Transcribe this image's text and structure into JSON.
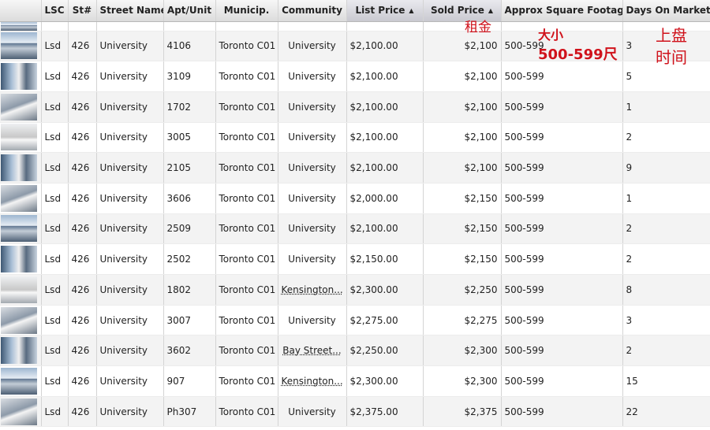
{
  "columns": [
    {
      "label": "",
      "sort": ""
    },
    {
      "label": "LSC",
      "sort": ""
    },
    {
      "label": "St#",
      "sort": ""
    },
    {
      "label": "Street Name",
      "sort": ""
    },
    {
      "label": "Apt/Unit",
      "sort": ""
    },
    {
      "label": "Municip.",
      "sort": ""
    },
    {
      "label": "Community",
      "sort": ""
    },
    {
      "label": "List Price",
      "sort": "▲"
    },
    {
      "label": "Sold Price",
      "sort": "▲"
    },
    {
      "label": "Approx Square Footage",
      "sort": ""
    },
    {
      "label": "Days On Market",
      "sort": ""
    }
  ],
  "rows": [
    {
      "lsc": "Lsd",
      "st": "426",
      "street": "University",
      "unit": "4106",
      "municip": "Toronto C01",
      "community": "University",
      "list_price": "$2,100.00",
      "sold_price": "$2,100",
      "sqft": "500-599",
      "dom": "3"
    },
    {
      "lsc": "Lsd",
      "st": "426",
      "street": "University",
      "unit": "3109",
      "municip": "Toronto C01",
      "community": "University",
      "list_price": "$2,100.00",
      "sold_price": "$2,100",
      "sqft": "500-599",
      "dom": "5"
    },
    {
      "lsc": "Lsd",
      "st": "426",
      "street": "University",
      "unit": "1702",
      "municip": "Toronto C01",
      "community": "University",
      "list_price": "$2,100.00",
      "sold_price": "$2,100",
      "sqft": "500-599",
      "dom": "1"
    },
    {
      "lsc": "Lsd",
      "st": "426",
      "street": "University",
      "unit": "3005",
      "municip": "Toronto C01",
      "community": "University",
      "list_price": "$2,100.00",
      "sold_price": "$2,100",
      "sqft": "500-599",
      "dom": "2"
    },
    {
      "lsc": "Lsd",
      "st": "426",
      "street": "University",
      "unit": "2105",
      "municip": "Toronto C01",
      "community": "University",
      "list_price": "$2,100.00",
      "sold_price": "$2,100",
      "sqft": "500-599",
      "dom": "9"
    },
    {
      "lsc": "Lsd",
      "st": "426",
      "street": "University",
      "unit": "3606",
      "municip": "Toronto C01",
      "community": "University",
      "list_price": "$2,000.00",
      "sold_price": "$2,150",
      "sqft": "500-599",
      "dom": "1"
    },
    {
      "lsc": "Lsd",
      "st": "426",
      "street": "University",
      "unit": "2509",
      "municip": "Toronto C01",
      "community": "University",
      "list_price": "$2,100.00",
      "sold_price": "$2,150",
      "sqft": "500-599",
      "dom": "2"
    },
    {
      "lsc": "Lsd",
      "st": "426",
      "street": "University",
      "unit": "2502",
      "municip": "Toronto C01",
      "community": "University",
      "list_price": "$2,150.00",
      "sold_price": "$2,150",
      "sqft": "500-599",
      "dom": "2"
    },
    {
      "lsc": "Lsd",
      "st": "426",
      "street": "University",
      "unit": "1802",
      "municip": "Toronto C01",
      "community": "Kensington...",
      "list_price": "$2,300.00",
      "sold_price": "$2,250",
      "sqft": "500-599",
      "dom": "8"
    },
    {
      "lsc": "Lsd",
      "st": "426",
      "street": "University",
      "unit": "3007",
      "municip": "Toronto C01",
      "community": "University",
      "list_price": "$2,275.00",
      "sold_price": "$2,275",
      "sqft": "500-599",
      "dom": "3"
    },
    {
      "lsc": "Lsd",
      "st": "426",
      "street": "University",
      "unit": "3602",
      "municip": "Toronto C01",
      "community": "Bay Street...",
      "list_price": "$2,250.00",
      "sold_price": "$2,300",
      "sqft": "500-599",
      "dom": "2"
    },
    {
      "lsc": "Lsd",
      "st": "426",
      "street": "University",
      "unit": "907",
      "municip": "Toronto C01",
      "community": "Kensington...",
      "list_price": "$2,300.00",
      "sold_price": "$2,300",
      "sqft": "500-599",
      "dom": "15"
    },
    {
      "lsc": "Lsd",
      "st": "426",
      "street": "University",
      "unit": "Ph307",
      "municip": "Toronto C01",
      "community": "University",
      "list_price": "$2,375.00",
      "sold_price": "$2,375",
      "sqft": "500-599",
      "dom": "22"
    }
  ],
  "annotations": {
    "rent": "租金",
    "size_line1": "大小",
    "size_line2": "500-599尺",
    "dom_line1": "上盘",
    "dom_line2": "时间"
  },
  "colors": {
    "annotation": "#d0121b",
    "header_bg": "#dcdcdc",
    "row_alt": "#f3f3f3"
  }
}
